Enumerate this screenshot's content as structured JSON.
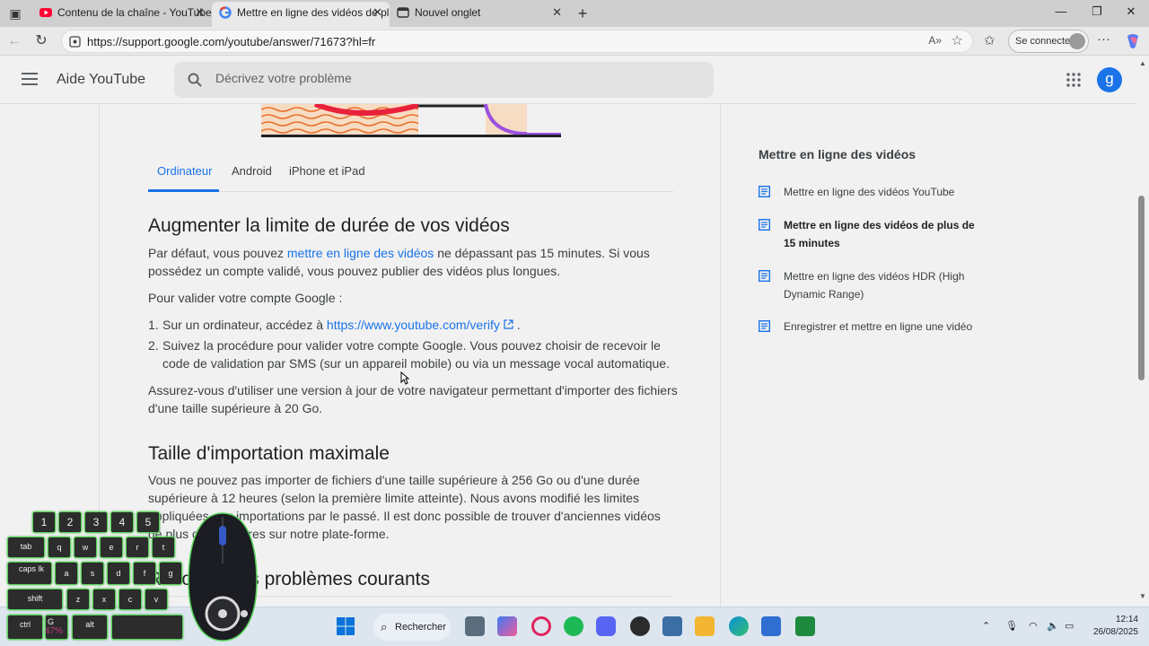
{
  "browser": {
    "tabs": [
      {
        "title": "Contenu de la chaîne - YouTube S",
        "icon": "youtube-icon",
        "active": false
      },
      {
        "title": "Mettre en ligne des vidéos de plu",
        "icon": "google-icon",
        "active": true
      },
      {
        "title": "Nouvel onglet",
        "icon": "newtab-icon",
        "active": false
      }
    ],
    "url": "https://support.google.com/youtube/answer/71673?hl=fr",
    "signin_label": "Se connecter"
  },
  "header": {
    "title": "Aide YouTube",
    "search_placeholder": "Décrivez votre problème",
    "avatar_initial": "g"
  },
  "article": {
    "device_tabs": [
      "Ordinateur",
      "Android",
      "iPhone et iPad"
    ],
    "active_tab": "Ordinateur",
    "section1": {
      "heading": "Augmenter la limite de durée de vos vidéos",
      "para1_before": "Par défaut, vous pouvez ",
      "para1_link": "mettre en ligne des vidéos",
      "para1_after": " ne dépassant pas 15 minutes. Si vous possédez un compte validé, vous pouvez publier des vidéos plus longues.",
      "para2": "Pour valider votre compte Google :",
      "step1_num": "1.",
      "step1_before": "Sur un ordinateur, accédez à ",
      "step1_link": "https://www.youtube.com/verify",
      "step1_after": " .",
      "step2_num": "2.",
      "step2": "Suivez la procédure pour valider votre compte Google. Vous pouvez choisir de recevoir le code de validation par SMS (sur un appareil mobile) ou via un message vocal automatique.",
      "para3": "Assurez-vous d'utiliser une version à jour de votre navigateur permettant d'importer des fichiers d'une taille supérieure à 20 Go."
    },
    "section2": {
      "heading": "Taille d'importation maximale",
      "para": "Vous ne pouvez pas importer de fichiers d'une taille supérieure à 256 Go ou d'une durée supérieure à 12 heures (selon la première limite atteinte). Nous avons modifié les limites appliquées aux importations par le passé. Il est donc possible de trouver d'anciennes vidéos de plus de 12 heures sur notre plate-forme."
    },
    "section3": {
      "heading": "Résoudre les problèmes courants"
    }
  },
  "sidebar": {
    "title": "Mettre en ligne des vidéos",
    "items": [
      {
        "label": "Mettre en ligne des vidéos YouTube",
        "current": false
      },
      {
        "label": "Mettre en ligne des vidéos de plus de 15 minutes",
        "current": true
      },
      {
        "label": "Mettre en ligne des vidéos HDR (High Dynamic Range)",
        "current": false
      },
      {
        "label": "Enregistrer et mettre en ligne une vidéo",
        "current": false
      }
    ]
  },
  "taskbar": {
    "search_label": "Rechercher",
    "time": "12:14",
    "date": "26/08/2025"
  },
  "key_overlay": {
    "number_row": [
      "1",
      "2",
      "3",
      "4",
      "5"
    ],
    "row_tab": [
      "tab",
      "q",
      "w",
      "e",
      "r",
      "t"
    ],
    "row_caps": [
      "caps lk",
      "a",
      "s",
      "d",
      "f",
      "g"
    ],
    "row_shift": [
      "shift",
      "z",
      "x",
      "c",
      "v"
    ],
    "row_bottom": [
      "ctrl",
      "G",
      "alt",
      ""
    ],
    "percent": "47%"
  },
  "colors": {
    "link": "#1a73e8",
    "accent": "#1a73e8",
    "key_glow": "#55d257"
  }
}
